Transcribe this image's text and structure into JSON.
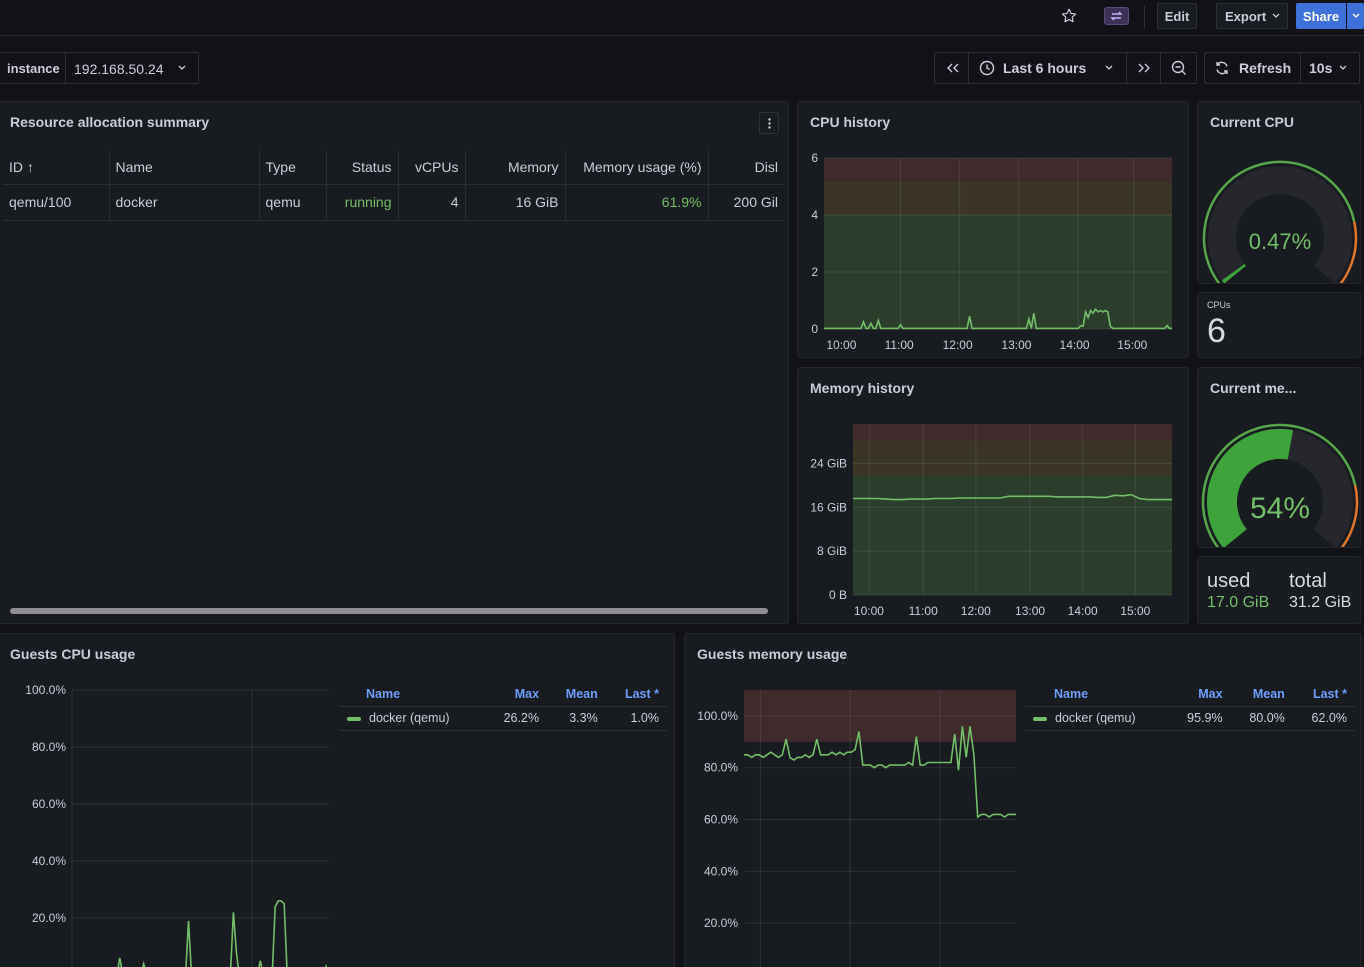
{
  "topbar": {
    "edit": "Edit",
    "export": "Export",
    "share": "Share"
  },
  "controls": {
    "instance_label": "instance",
    "instance_value": "192.168.50.24",
    "time_range": "Last 6 hours",
    "refresh": "Refresh",
    "refresh_interval": "10s"
  },
  "resource_panel": {
    "title": "Resource allocation summary",
    "columns": [
      "ID ↑",
      "Name",
      "Type",
      "Status",
      "vCPUs",
      "Memory",
      "Memory usage (%)",
      "Disl"
    ],
    "rows": [
      [
        "qemu/100",
        "docker",
        "qemu",
        "running",
        "4",
        "16 GiB",
        "61.9%",
        "200 Gil"
      ]
    ]
  },
  "cpu_history": {
    "title": "CPU history",
    "chart_data": {
      "type": "line",
      "x_ticks": [
        "10:00",
        "11:00",
        "12:00",
        "13:00",
        "14:00",
        "15:00"
      ],
      "y_ticks": [
        "0",
        "2",
        "4",
        "6"
      ],
      "ylim": [
        0,
        6
      ],
      "thresholds": [
        {
          "from": 0,
          "to": 4,
          "color": "#2b3d2b"
        },
        {
          "from": 4,
          "to": 5.2,
          "color": "#3b3526"
        },
        {
          "from": 5.2,
          "to": 6,
          "color": "#3f2a2c"
        }
      ],
      "series": [
        {
          "values": [
            0.02,
            0.02,
            0.02,
            0.02,
            0.02,
            0.02,
            0.02,
            0.02,
            0.02,
            0.02,
            0.02,
            0.02,
            0.02,
            0.02,
            0.02,
            0.02,
            0.25,
            0.02,
            0.02,
            0.2,
            0.02,
            0.02,
            0.3,
            0.02,
            0.02,
            0.02,
            0.02,
            0.02,
            0.02,
            0.02,
            0.02,
            0.15,
            0.02,
            0.02,
            0.02,
            0.02,
            0.02,
            0.02,
            0.02,
            0.02,
            0.02,
            0.02,
            0.02,
            0.02,
            0.02,
            0.02,
            0.02,
            0.02,
            0.02,
            0.02,
            0.02,
            0.02,
            0.02,
            0.02,
            0.02,
            0.02,
            0.02,
            0.02,
            0.02,
            0.45,
            0.02,
            0.02,
            0.02,
            0.02,
            0.02,
            0.02,
            0.02,
            0.02,
            0.02,
            0.02,
            0.02,
            0.02,
            0.02,
            0.02,
            0.02,
            0.02,
            0.02,
            0.02,
            0.02,
            0.02,
            0.02,
            0.02,
            0.02,
            0.35,
            0.02,
            0.55,
            0.02,
            0.02,
            0.02,
            0.02,
            0.02,
            0.02,
            0.02,
            0.02,
            0.02,
            0.02,
            0.02,
            0.02,
            0.02,
            0.02,
            0.02,
            0.02,
            0.02,
            0.02,
            0.12,
            0.1,
            0.6,
            0.4,
            0.65,
            0.55,
            0.7,
            0.6,
            0.65,
            0.6,
            0.65,
            0.6,
            0.1,
            0.02,
            0.02,
            0.02,
            0.02,
            0.02,
            0.02,
            0.02,
            0.02,
            0.02,
            0.02,
            0.02,
            0.02,
            0.02,
            0.02,
            0.02,
            0.02,
            0.02,
            0.02,
            0.02,
            0.02,
            0.02,
            0.02,
            0.12,
            0.02,
            0.02
          ]
        }
      ]
    }
  },
  "current_cpu": {
    "title": "Current CPU",
    "value": "0.47%",
    "fraction": 0.0047
  },
  "cpus": {
    "label": "CPUs",
    "value": "6"
  },
  "memory_history": {
    "title": "Memory history",
    "chart_data": {
      "type": "line",
      "x_ticks": [
        "10:00",
        "11:00",
        "12:00",
        "13:00",
        "14:00",
        "15:00"
      ],
      "y_ticks": [
        "0 B",
        "8 GiB",
        "16 GiB",
        "24 GiB"
      ],
      "ylim": [
        0,
        31.2
      ],
      "thresholds": [
        {
          "from": 0,
          "to": 21.8,
          "color": "#2b3d2b"
        },
        {
          "from": 21.8,
          "to": 28.1,
          "color": "#3b3526"
        },
        {
          "from": 28.1,
          "to": 31.2,
          "color": "#3f2a2c"
        }
      ],
      "series": [
        {
          "values": [
            17.6,
            17.6,
            17.6,
            17.6,
            17.5,
            17.4,
            17.4,
            17.5,
            17.5,
            17.5,
            17.6,
            17.6,
            17.6,
            17.7,
            17.7,
            17.7,
            17.7,
            17.7,
            17.7,
            18.0,
            18.0,
            18.0,
            18.0,
            18.0,
            18.0,
            17.9,
            17.9,
            17.9,
            17.9,
            17.9,
            17.8,
            17.8,
            18.2,
            18.1,
            18.3,
            17.6,
            17.4,
            17.4,
            17.4,
            17.4
          ]
        }
      ]
    }
  },
  "current_memory": {
    "title": "Current me...",
    "value": "54%",
    "fraction": 0.54
  },
  "memory_stat": {
    "used_label": "used",
    "used_value": "17.0 GiB",
    "total_label": "total",
    "total_value": "31.2 GiB"
  },
  "guests_cpu": {
    "title": "Guests CPU usage",
    "legend_headers": [
      "Name",
      "Max",
      "Mean",
      "Last *"
    ],
    "legend_rows": [
      {
        "name": "docker (qemu)",
        "max": "26.2%",
        "mean": "3.3%",
        "last": "1.0%",
        "color": "#73bf69"
      }
    ],
    "chart_data": {
      "type": "line",
      "y_ticks": [
        "20.0%",
        "40.0%",
        "60.0%",
        "80.0%",
        "100.0%"
      ],
      "ylim": [
        0,
        100
      ],
      "series": [
        {
          "name": "docker (qemu)",
          "values": [
            0,
            0,
            0,
            0,
            0,
            0,
            0,
            0,
            0,
            0,
            0,
            0,
            0,
            0,
            0,
            0,
            6,
            0,
            0,
            0,
            0,
            0,
            0,
            0,
            4,
            0,
            0,
            0,
            0,
            0,
            0,
            0,
            0,
            0,
            0,
            0,
            0,
            0,
            0,
            19,
            0,
            0,
            0,
            0,
            0,
            0,
            0,
            0,
            0,
            0,
            0,
            0,
            0,
            0,
            22,
            8,
            0,
            0,
            0,
            0,
            0,
            0,
            0,
            5,
            0,
            0,
            0,
            0,
            24,
            26,
            26,
            25,
            0,
            0,
            0,
            0,
            0,
            0,
            0,
            0,
            0,
            0,
            0,
            0,
            0,
            3,
            0
          ]
        }
      ]
    }
  },
  "guests_memory": {
    "title": "Guests memory usage",
    "legend_headers": [
      "Name",
      "Max",
      "Mean",
      "Last *"
    ],
    "legend_rows": [
      {
        "name": "docker (qemu)",
        "max": "95.9%",
        "mean": "80.0%",
        "last": "62.0%",
        "color": "#73bf69"
      }
    ],
    "chart_data": {
      "type": "line",
      "y_ticks": [
        "20.0%",
        "40.0%",
        "60.0%",
        "80.0%",
        "100.0%"
      ],
      "ylim": [
        0,
        110
      ],
      "thresholds": [
        {
          "from": 90,
          "to": 110,
          "color": "#3f2a2c"
        }
      ],
      "series": [
        {
          "name": "docker (qemu)",
          "values": [
            85,
            85,
            84,
            85,
            85,
            84,
            85,
            86,
            85,
            84,
            85,
            91,
            84,
            83,
            84,
            84,
            85,
            84,
            85,
            91,
            85,
            85,
            85,
            86,
            85,
            86,
            85,
            86,
            86,
            87,
            94,
            81,
            81,
            81,
            80,
            81,
            81,
            80,
            81,
            81,
            81,
            81,
            81,
            82,
            81,
            92,
            81,
            81,
            82,
            82,
            82,
            82,
            82,
            82,
            82,
            93,
            79,
            96,
            84,
            96,
            85,
            61,
            62,
            62,
            61,
            62,
            62,
            62,
            61,
            62,
            62,
            62
          ]
        }
      ]
    }
  }
}
